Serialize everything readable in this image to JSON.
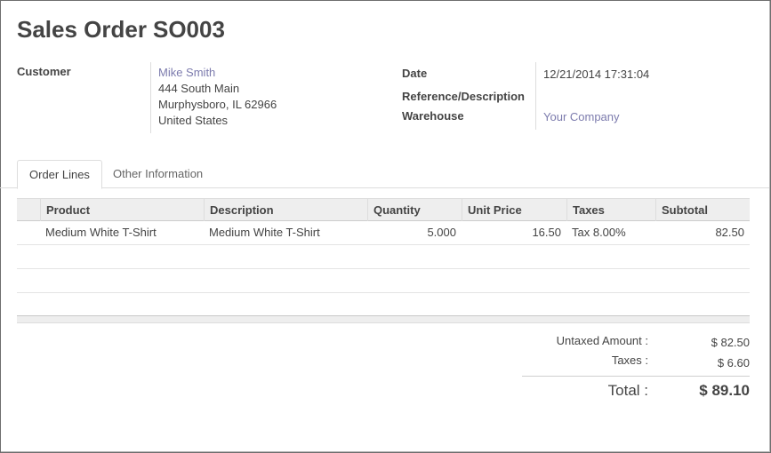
{
  "header": {
    "title_prefix": "Sales Order",
    "order_number": "SO003"
  },
  "customer": {
    "label": "Customer",
    "name": "Mike Smith",
    "address_line1": "444 South Main",
    "address_line2": "Murphysboro, IL 62966",
    "country": "United States"
  },
  "info": {
    "date_label": "Date",
    "date_value": "12/21/2014 17:31:04",
    "reference_label": "Reference/Description",
    "reference_value": "",
    "warehouse_label": "Warehouse",
    "warehouse_value": "Your Company"
  },
  "tabs": [
    {
      "label": "Order Lines",
      "active": true
    },
    {
      "label": "Other Information",
      "active": false
    }
  ],
  "order_lines": {
    "columns": [
      "Product",
      "Description",
      "Quantity",
      "Unit Price",
      "Taxes",
      "Subtotal"
    ],
    "rows": [
      {
        "product": "Medium White T-Shirt",
        "description": "Medium White T-Shirt",
        "quantity": "5.000",
        "unit_price": "16.50",
        "taxes": "Tax 8.00%",
        "subtotal": "82.50"
      }
    ]
  },
  "totals": {
    "untaxed_label": "Untaxed Amount :",
    "untaxed_value": "$ 82.50",
    "taxes_label": "Taxes :",
    "taxes_value": "$ 6.60",
    "total_label": "Total :",
    "total_value": "$ 89.10"
  },
  "colors": {
    "link": "#7c7bad",
    "text": "#444444",
    "grid_header": "#eeeeee"
  }
}
